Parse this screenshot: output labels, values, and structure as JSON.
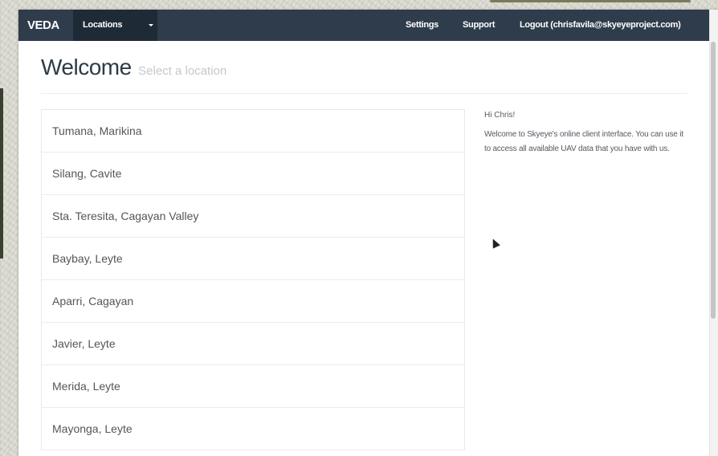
{
  "navbar": {
    "brand": "VEDA",
    "active_item": "Locations",
    "dropdown_icon": "caret-down-icon",
    "settings": "Settings",
    "support": "Support",
    "logout": "Logout (chrisfavila@skyeyeproject.com)"
  },
  "page": {
    "title": "Welcome",
    "subtitle": "Select a location"
  },
  "locations": [
    "Tumana, Marikina",
    "Silang, Cavite",
    "Sta. Teresita, Cagayan Valley",
    "Baybay, Leyte",
    "Aparri, Cagayan",
    "Javier, Leyte",
    "Merida, Leyte",
    "Mayonga, Leyte"
  ],
  "sidebar": {
    "greeting": "Hi Chris!",
    "message": "Welcome to Skyeye's online client interface. You can use it to access all available UAV data that you have with us."
  },
  "colors": {
    "navbar_bg": "#2f3c4c",
    "navbar_active_bg": "#1f2a37",
    "title_text": "#2e3a48",
    "subtitle_text": "#c4c8cc"
  },
  "icons": {
    "cursor": "mouse-pointer-icon"
  }
}
